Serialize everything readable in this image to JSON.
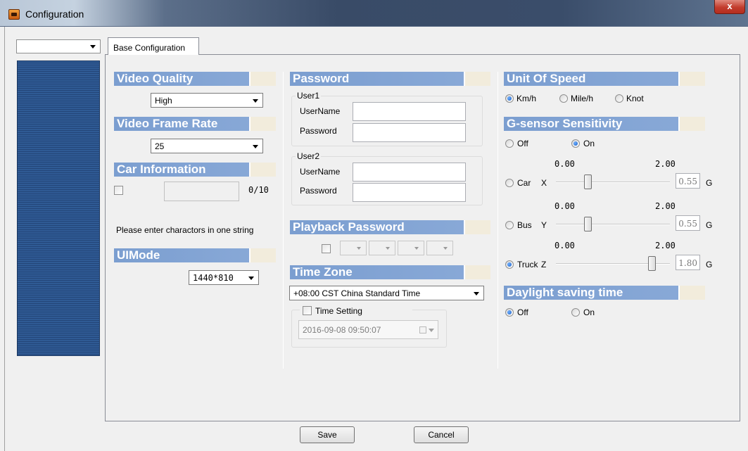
{
  "window": {
    "title": "Configuration",
    "close_glyph": "x",
    "app_icon": "camera-app-icon"
  },
  "tab": {
    "label": "Base Configuration"
  },
  "video_quality": {
    "heading": "Video Quality",
    "value": "High"
  },
  "video_frame_rate": {
    "heading": "Video Frame Rate",
    "value": "25"
  },
  "car_information": {
    "heading": "Car Information",
    "counter": "0/10",
    "hint": "Please enter charactors in one string"
  },
  "ui_mode": {
    "heading": "UIMode",
    "value": "1440*810"
  },
  "password": {
    "heading": "Password",
    "user1": {
      "group": "User1",
      "username_label": "UserName",
      "password_label": "Password"
    },
    "user2": {
      "group": "User2",
      "username_label": "UserName",
      "password_label": "Password"
    }
  },
  "playback_password": {
    "heading": "Playback Password"
  },
  "time_zone": {
    "heading": "Time Zone",
    "value": "+08:00 CST China Standard Time",
    "time_setting_label": "Time Setting",
    "datetime": "2016-09-08 09:50:07"
  },
  "unit_of_speed": {
    "heading": "Unit Of Speed",
    "options": [
      "Km/h",
      "Mile/h",
      "Knot"
    ],
    "selected": "Km/h"
  },
  "gsensor": {
    "heading": "G-sensor Sensitivity",
    "off_label": "Off",
    "on_label": "On",
    "selected": "On",
    "unit": "G",
    "rows": [
      {
        "label": "Car",
        "axis": "X",
        "min": "0.00",
        "max": "2.00",
        "value": "0.55",
        "selected": false
      },
      {
        "label": "Bus",
        "axis": "Y",
        "min": "0.00",
        "max": "2.00",
        "value": "0.55",
        "selected": false
      },
      {
        "label": "Truck",
        "axis": "Z",
        "min": "0.00",
        "max": "2.00",
        "value": "1.80",
        "selected": true
      }
    ]
  },
  "daylight": {
    "heading": "Daylight saving time",
    "off_label": "Off",
    "on_label": "On",
    "selected": "Off"
  },
  "buttons": {
    "save": "Save",
    "cancel": "Cancel"
  },
  "colors": {
    "section_header": "#7b9ed0",
    "nav_list": "#2f5a94",
    "close_button": "#c23c2d"
  }
}
